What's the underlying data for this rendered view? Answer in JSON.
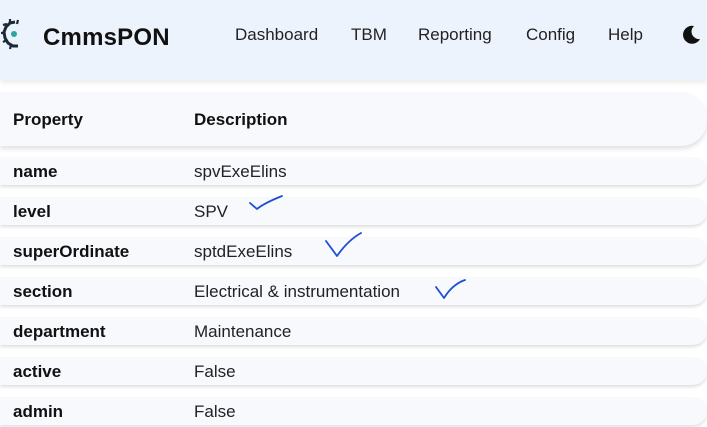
{
  "navbar": {
    "brand": "CmmsPON",
    "links": [
      "Dashboard",
      "TBM",
      "Reporting",
      "Config",
      "Help"
    ],
    "logo_icon": "gear-logo-icon",
    "theme_icon": "moon-icon",
    "background": "#edf3fc"
  },
  "table": {
    "headers": {
      "property": "Property",
      "description": "Description"
    },
    "rows": [
      {
        "property": "name",
        "description": "spvExeElins"
      },
      {
        "property": "level",
        "description": "SPV"
      },
      {
        "property": "superOrdinate",
        "description": "sptdExeElins"
      },
      {
        "property": "section",
        "description": "Electrical & instrumentation"
      },
      {
        "property": "department",
        "description": "Maintenance"
      },
      {
        "property": "active",
        "description": "False"
      },
      {
        "property": "admin",
        "description": "False"
      }
    ]
  },
  "annotations": {
    "checkmark_color": "#1f4fd0",
    "checkmark_icon": "handwritten-checkmark-icon"
  }
}
